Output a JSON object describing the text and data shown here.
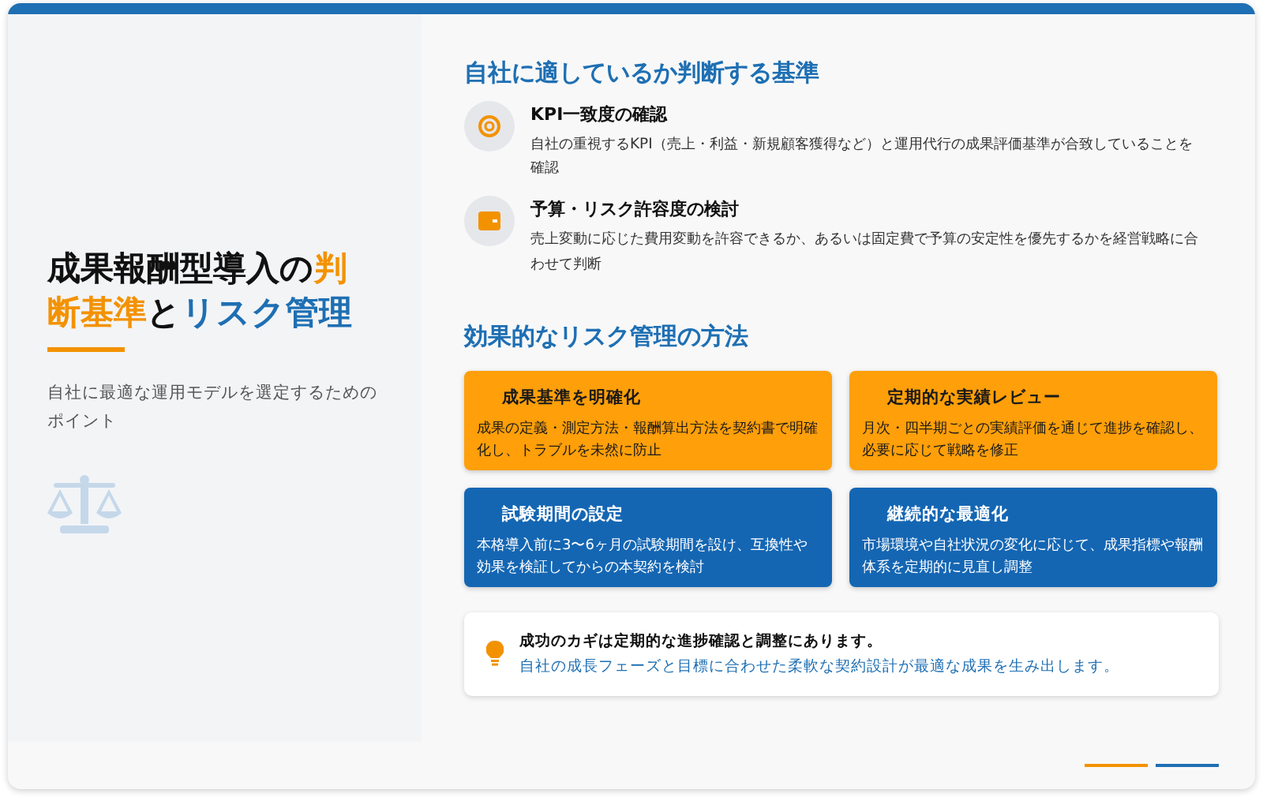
{
  "left": {
    "title": [
      {
        "text": "成果報酬型導入の",
        "kind": "plain"
      },
      {
        "text": "判断基準",
        "kind": "accent"
      },
      {
        "text": "と",
        "kind": "plain"
      },
      {
        "text": "リスク管理",
        "kind": "primary"
      }
    ],
    "subtitle": "自社に最適な運用モデルを選定するためのポイント"
  },
  "criteria": {
    "heading": "自社に適しているか判断する基準",
    "items": [
      {
        "kind": "target",
        "title": "KPI一致度の確認",
        "text": "自社の重視するKPI（売上・利益・新規顧客獲得など）と運用代行の成果評価基準が合致していることを確認"
      },
      {
        "kind": "wallet",
        "title": "予算・リスク許容度の検討",
        "text": "売上変動に応じた費用変動を許容できるか、あるいは固定費で予算の安定性を優先するかを経営戦略に合わせて判断"
      }
    ]
  },
  "risk": {
    "heading": "効果的なリスク管理の方法",
    "cards": [
      {
        "kind": "orange",
        "title": "成果基準を明確化",
        "text": "成果の定義・測定方法・報酬算出方法を契約書で明確化し、トラブルを未然に防止"
      },
      {
        "kind": "orange",
        "title": "定期的な実績レビュー",
        "text": "月次・四半期ごとの実績評価を通じて進捗を確認し、必要に応じて戦略を修正"
      },
      {
        "kind": "blue",
        "title": "試験期間の設定",
        "text": "本格導入前に3〜6ヶ月の試験期間を設け、互換性や効果を検証してからの本契約を検討"
      },
      {
        "kind": "blue",
        "title": "継続的な最適化",
        "text": "市場環境や自社状況の変化に応じて、成果指標や報酬体系を定期的に見直し調整"
      }
    ]
  },
  "tip": {
    "title": "成功のカギは定期的な進捗確認と調整にあります。",
    "text": "自社の成長フェーズと目標に合わせた柔軟な契約設計が最適な成果を生み出します。"
  }
}
